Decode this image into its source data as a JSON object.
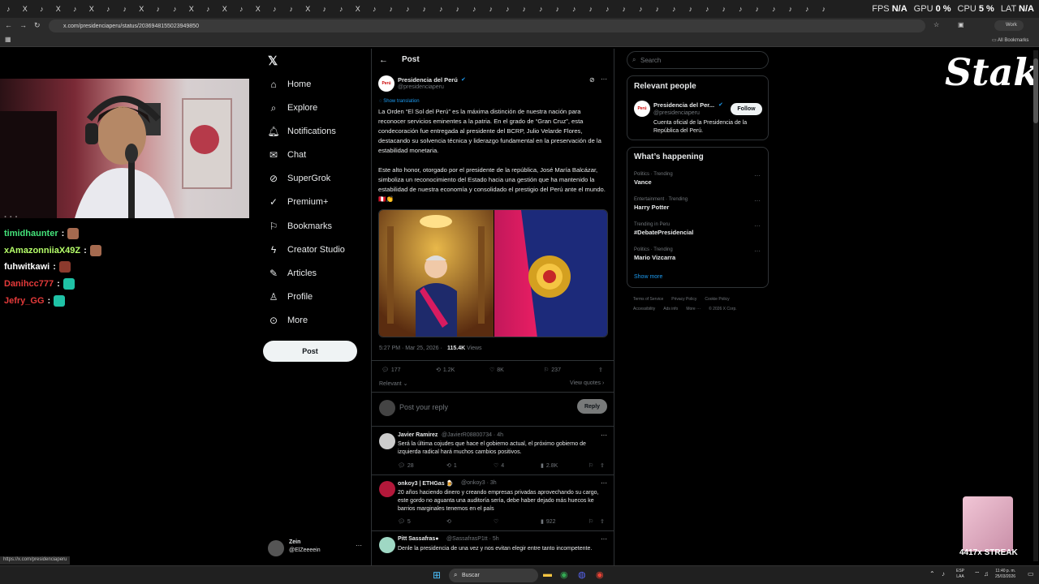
{
  "browser": {
    "tab_icons": [
      "♪",
      "X",
      "♪",
      "X",
      "♪",
      "X",
      "♪",
      "♪",
      "X",
      "♪",
      "♪",
      "X",
      "♪",
      "X",
      "♪",
      "X",
      "♪",
      "♪",
      "X",
      "♪",
      "♪",
      "X",
      "♪",
      "♪",
      "♪",
      "♪",
      "♪",
      "♪",
      "♪",
      "♪",
      "♪",
      "♪",
      "♪",
      "♪",
      "♪",
      "♪",
      "♪",
      "♪",
      "♪",
      "♪",
      "♪",
      "♪",
      "♪",
      "♪",
      "♪",
      "♪",
      "♪",
      "♪",
      "♪",
      "♪",
      "♪"
    ],
    "url": "x.com/presidenciaperu/status/2036948155023949850",
    "profile": "Work",
    "all_bookmarks": "All Bookmarks",
    "status_url": "https://x.com/presidenciaperu"
  },
  "overlay": {
    "fps_label": "FPS",
    "fps_value": "N/A",
    "gpu_label": "GPU",
    "gpu_value": "0 %",
    "cpu_label": "CPU",
    "cpu_value": "5 %",
    "lat_label": "LAT",
    "lat_value": "N/A",
    "stake_logo": "Stake",
    "streak": "4417x STREAK"
  },
  "stream_chat": [
    {
      "user": "timidhaunter",
      "color": "#44e37a"
    },
    {
      "user": "xAmazonniiaX49Z",
      "color": "#b6ff6a"
    },
    {
      "user": "fuhwitkawi",
      "color": "#ffffff"
    },
    {
      "user": "Danihcc777",
      "color": "#e53a3a"
    },
    {
      "user": "Jefry_GG",
      "color": "#e53a3a"
    }
  ],
  "nav": {
    "items": [
      "Home",
      "Explore",
      "Notifications",
      "Chat",
      "SuperGrok",
      "Premium+",
      "Bookmarks",
      "Creator Studio",
      "Articles",
      "Profile",
      "More"
    ],
    "post_button": "Post",
    "account_name": "Zein",
    "account_handle": "@ElZeeeein"
  },
  "post": {
    "header": "Post",
    "author": "Presidencia del Perú",
    "handle": "@presidenciaperu",
    "avatar_text": "Perú",
    "show_translation": "Show translation",
    "text1": "La Orden “El Sol del Perú” es la máxima distinción de nuestra nación para reconocer servicios eminentes a la patria. En el grado de “Gran Cruz”, esta condecoración fue entregada al presidente del BCRP, Julio Velarde Flores, destacando su solvencia técnica y liderazgo fundamental en la preservación de la estabilidad monetaria.",
    "text2": "Este alto honor, otorgado por el presidente de la república, José María Balcázar, simboliza un reconocimiento del Estado hacia una gestión que ha mantenido la estabilidad de nuestra economía y consolidado el prestigio del Perú ante el mundo. 🇵🇪👏",
    "timestamp": "5:27 PM · Mar 25, 2026 ·",
    "views_count": "115.4K",
    "views_label": "Views",
    "replies": "177",
    "reposts": "1.2K",
    "likes": "8K",
    "bookmarks": "237",
    "sort": "Relevant",
    "view_quotes": "View quotes",
    "reply_placeholder": "Post your reply",
    "reply_button": "Reply"
  },
  "replies": [
    {
      "name": "Javier Ramirez",
      "handle": "@JavierR08800734 · 4h",
      "text": "Será la última cojudes que hace el gobierno actual, el próximo gobierno de izquierda radical hará muchos cambios positivos.",
      "replies": "28",
      "reposts": "1",
      "likes": "4",
      "views": "2.8K"
    },
    {
      "name": "onkoy3 | ETHGas 🍺",
      "handle": "@onkoy3 · 3h",
      "text": "20 años haciendo dinero y creando empresas privadas aprovechando su cargo, este gordo no aguanta una auditoría sería, debe haber dejado más huecos ke barrios marginales tenemos en el país",
      "replies": "5",
      "reposts": "",
      "likes": "",
      "views": "922"
    },
    {
      "name": "Pitt Sassafras●",
      "handle": "@SassafrasP1tt · 5h",
      "text": "Denle la presidencia de una vez y nos evitan elegir entre tanto incompetente.",
      "replies": "",
      "reposts": "",
      "likes": "",
      "views": ""
    }
  ],
  "right": {
    "search_placeholder": "Search",
    "relevant_title": "Relevant people",
    "person_name": "Presidencia del Per...",
    "person_handle": "@presidenciaperu",
    "person_bio": "Cuenta oficial de la Presidencia de la República del Perú.",
    "follow": "Follow",
    "happening_title": "What’s happening",
    "trends": [
      {
        "meta": "Politics · Trending",
        "name": "Vance"
      },
      {
        "meta": "Entertainment · Trending",
        "name": "Harry Potter"
      },
      {
        "meta": "Trending in Peru",
        "name": "#DebatePresidencial"
      },
      {
        "meta": "Politics · Trending",
        "name": "Mario Vizcarra"
      }
    ],
    "show_more": "Show more",
    "footer1": [
      "Terms of Service",
      "Privacy Policy",
      "Cookie Policy"
    ],
    "footer2": [
      "Accessibility",
      "Ads info",
      "More ···",
      "© 2026 X Corp."
    ]
  },
  "taskbar": {
    "search": "Buscar",
    "lang1": "ESP",
    "lang2": "LAA",
    "time": "11:40 p. m.",
    "date": "25/03/2026"
  }
}
